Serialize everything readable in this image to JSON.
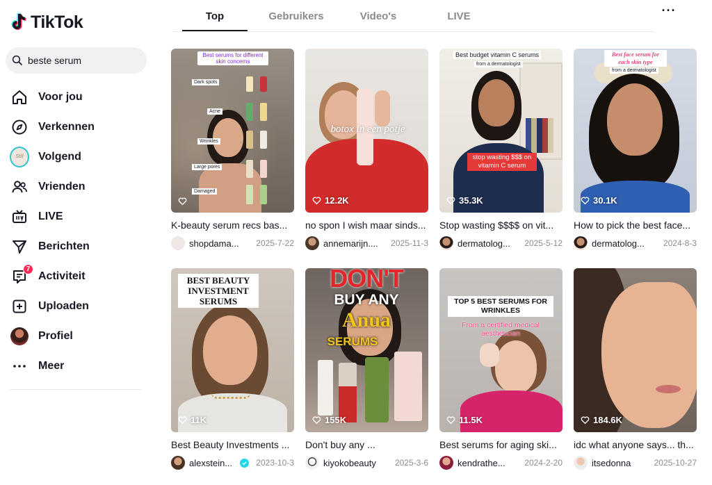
{
  "app": {
    "logo_text": "TikTok"
  },
  "search": {
    "value": "beste serum"
  },
  "sidebar": {
    "items": [
      {
        "label": "Voor jou",
        "icon": "home-icon"
      },
      {
        "label": "Verkennen",
        "icon": "compass-icon"
      },
      {
        "label": "Volgend",
        "icon": "following-avatar"
      },
      {
        "label": "Vrienden",
        "icon": "friends-icon"
      },
      {
        "label": "LIVE",
        "icon": "live-tv-icon"
      },
      {
        "label": "Berichten",
        "icon": "send-icon"
      },
      {
        "label": "Activiteit",
        "icon": "activity-icon",
        "badge": "7"
      },
      {
        "label": "Uploaden",
        "icon": "upload-icon"
      },
      {
        "label": "Profiel",
        "icon": "profile-avatar"
      },
      {
        "label": "Meer",
        "icon": "more-icon"
      }
    ]
  },
  "tabs": [
    {
      "label": "Top",
      "active": true
    },
    {
      "label": "Gebruikers",
      "active": false
    },
    {
      "label": "Video's",
      "active": false
    },
    {
      "label": "LIVE",
      "active": false
    }
  ],
  "videos": [
    {
      "desc": "K-beauty serum recs bas...",
      "user": "shopdama...",
      "date": "2025-7-22",
      "likes": "",
      "overlay": {
        "title": "Best serums for different skin concerns",
        "labels": [
          "Dark spots",
          "Acne",
          "Wrinkles",
          "Large pores",
          "Damaged"
        ]
      }
    },
    {
      "desc": "no spon I wish maar sinds...",
      "user": "annemarijn....",
      "date": "2025-11-3",
      "likes": "12.2K",
      "overlay": {
        "caption": "botox in een potje"
      }
    },
    {
      "desc": "Stop wasting $$$$ on vit...",
      "user": "dermatolog...",
      "date": "2025-5-12",
      "likes": "35.3K",
      "overlay": {
        "title": "Best budget vitamin C serums",
        "subtitle": "from a dermatologist",
        "caption": "stop wasting $$$ on vitamin C serum"
      }
    },
    {
      "desc": "How to pick the best face...",
      "user": "dermatolog...",
      "date": "2024-8-3",
      "likes": "30.1K",
      "overlay": {
        "title": "Best face serum for each skin type",
        "subtitle": "from a dermatologist"
      }
    },
    {
      "desc": "Best Beauty Investments ...",
      "user": "alexstein...",
      "date": "2023-10-3",
      "likes": "11K",
      "verified": true,
      "overlay": {
        "title": "BEST BEAUTY INVESTMENT SERUMS"
      }
    },
    {
      "desc": "Don't buy any ...",
      "user": "kiyokobeauty",
      "date": "2025-3-6",
      "likes": "155K",
      "overlay": {
        "line1": "DON'T",
        "line2": "BUY ANY",
        "line3": "Anua",
        "line4": "SERUMS"
      }
    },
    {
      "desc": "Best serums for aging ski...",
      "user": "kendrathe...",
      "date": "2024-2-20",
      "likes": "11.5K",
      "overlay": {
        "title": "TOP 5 BEST SERUMS FOR WRINKLES",
        "caption": "From a certified medical aesthetician"
      }
    },
    {
      "desc": "idc what anyone says... th...",
      "user": "itsedonna",
      "date": "2025-10-27",
      "likes": "184.6K",
      "overlay": {}
    }
  ],
  "colors": {
    "accent": "#fe2c55",
    "teal": "#20d5ec",
    "text": "#161823",
    "muted": "#8a8b91"
  }
}
